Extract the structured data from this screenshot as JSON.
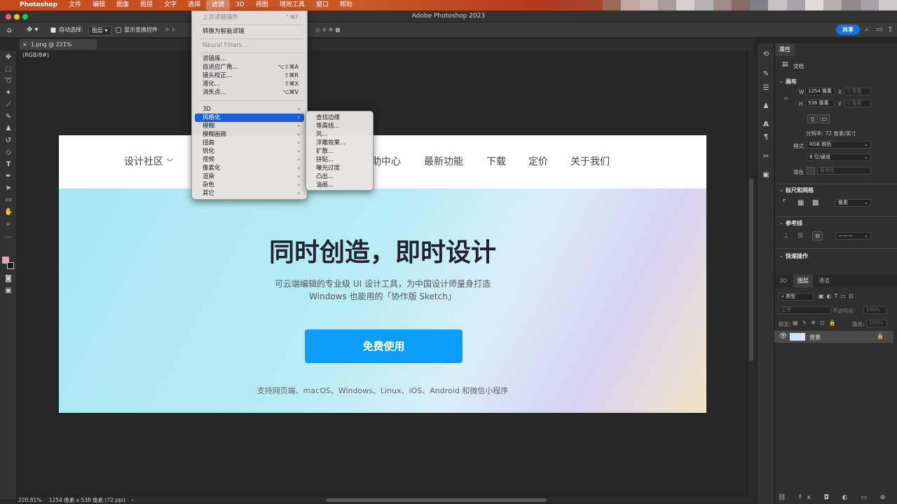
{
  "menubar": {
    "apple_icon": "apple-icon",
    "items": [
      "Photoshop",
      "文件",
      "编辑",
      "图像",
      "图层",
      "文字",
      "选择",
      "滤镜",
      "3D",
      "视图",
      "增效工具",
      "窗口",
      "帮助"
    ],
    "active": "滤镜",
    "pixel_colors": [
      "#9a6b5a",
      "#c2a7a2",
      "#cbb8b4",
      "#a99b9a",
      "#d8cfcf",
      "#b5b1b3",
      "#9f8b8a",
      "#8a6a66",
      "#7f7f85",
      "#c9c2c4",
      "#a8a3a6",
      "#e0dadb",
      "#b7aeb0",
      "#93898a",
      "#a6a1a4",
      "#cfcacc"
    ]
  },
  "window": {
    "title": "Adobe Photoshop 2023",
    "doc_tab": "1.png @ 221%(RGB/8#)"
  },
  "options": {
    "auto_select_label": "自动选择:",
    "auto_select_value": "图层",
    "show_transform_label": "显示变换控件",
    "share_label": "共享"
  },
  "filter_menu": {
    "last_filter": "上次滤镜操作",
    "last_filter_shortcut": "^⌘F",
    "convert_smart": "转换为智能滤镜",
    "neural": "Neural Filters...",
    "gallery": "滤镜库...",
    "adaptive": "自适应广角...",
    "adaptive_shortcut": "⌥⇧⌘A",
    "lens": "镜头校正...",
    "lens_shortcut": "⇧⌘R",
    "liquify": "液化...",
    "liquify_shortcut": "⇧⌘X",
    "vanish": "消失点...",
    "vanish_shortcut": "⌥⌘V",
    "groups": [
      "3D",
      "风格化",
      "模糊",
      "模糊画廊",
      "扭曲",
      "锐化",
      "视频",
      "像素化",
      "渲染",
      "杂色",
      "其它"
    ],
    "highlighted": "风格化"
  },
  "stylize_submenu": {
    "items": [
      "查找边缘",
      "等高线...",
      "风...",
      "浮雕效果...",
      "扩散...",
      "拼贴...",
      "曝光过度",
      "凸出...",
      "油画..."
    ]
  },
  "canvas": {
    "nav": [
      "设计社区",
      "助中心",
      "最新功能",
      "下载",
      "定价",
      "关于我们"
    ],
    "nav_caret": "chevron-down-icon",
    "headline": "同时创造，即时设计",
    "subline1": "可云端编辑的专业级 UI 设计工具，为中国设计师量身打造",
    "subline2": "Windows 也能用的「协作版 Sketch」",
    "cta": "免费使用",
    "platforms": "支持网页端、macOS、Windows、Linux、iOS、Android 和微信小程序"
  },
  "status": {
    "zoom": "220.81%",
    "dimensions": "1254 像素 x 538 像素 (72 ppi)"
  },
  "properties": {
    "tab": "属性",
    "doc_label": "文档",
    "canvas_section": "画布",
    "w_label": "W",
    "w_value": "1254 像素",
    "x_label": "X",
    "x_placeholder": "0 像素",
    "h_label": "H",
    "h_value": "538 像素",
    "y_label": "Y",
    "y_placeholder": "0 像素",
    "resolution": "分辨率: 72 像素/英寸",
    "mode_label": "模式",
    "mode_value": "RGB 颜色",
    "depth_value": "8 位/通道",
    "fill_label": "填色",
    "fill_value": "背景色",
    "rulers_section": "标尺和网格",
    "rulers_unit": "像素",
    "guides_section": "参考线",
    "guides_line": "———",
    "quick_actions": "快速操作"
  },
  "layers": {
    "tabs": [
      "3D",
      "图层",
      "通道"
    ],
    "active_tab": "图层",
    "filter_kind": "类型",
    "blend_mode": "正常",
    "opacity_label": "不透明度:",
    "opacity_value": "100%",
    "lock_label": "锁定:",
    "fill_label": "填充:",
    "fill_value": "100%",
    "layer_name": "背景"
  },
  "colors": {
    "accent": "#1473e6",
    "menu_highlight": "#1d5fd8",
    "cta": "#0b9ef8",
    "foreground_swatch": "#e8a3b3",
    "background_swatch": "#1a1a1a"
  }
}
